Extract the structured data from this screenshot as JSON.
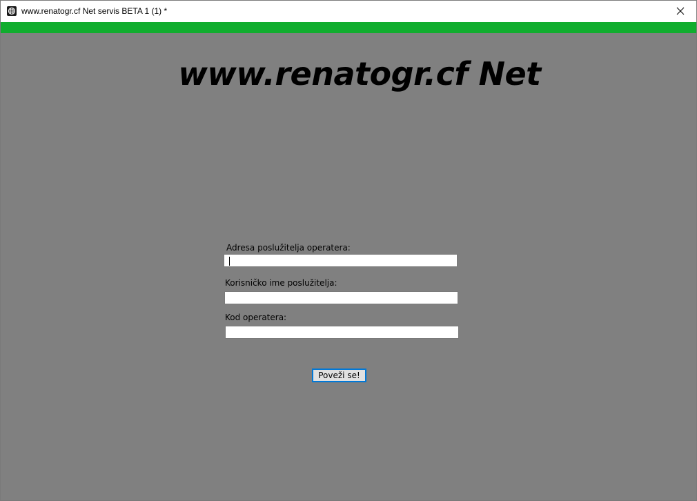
{
  "window": {
    "title": "www.renatogr.cf Net servis BETA 1 (1) *",
    "accent_color": "#10ad2e",
    "background_color": "#808080"
  },
  "main": {
    "heading": "www.renatogr.cf Net",
    "fields": [
      {
        "label": "Adresa poslužitelja operatera:",
        "value": ""
      },
      {
        "label": "Korisničko ime poslužitelja:",
        "value": ""
      },
      {
        "label": "Kod operatera:",
        "value": ""
      }
    ],
    "connect_label": "Poveži se!"
  },
  "icons": {
    "app": "globe-app-icon",
    "close": "close-icon"
  }
}
